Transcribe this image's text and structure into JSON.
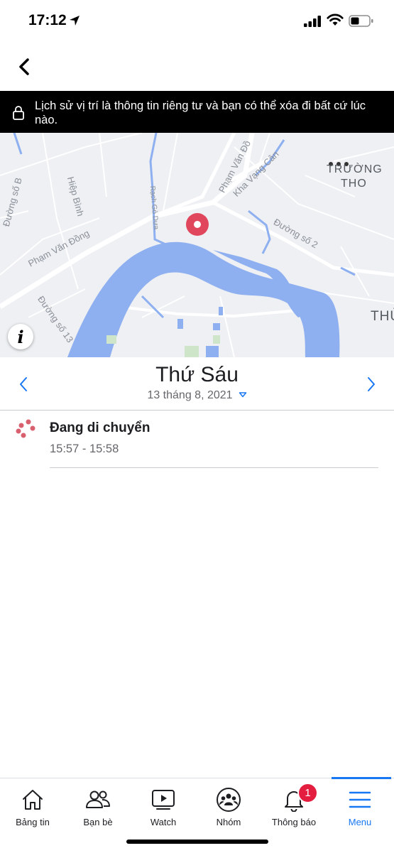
{
  "status_bar": {
    "time": "17:12",
    "icons": [
      "location-arrow-icon",
      "signal-icon",
      "wifi-icon",
      "battery-icon"
    ]
  },
  "nav": {
    "back_icon": "chevron-left-icon"
  },
  "privacy_banner": {
    "icon": "lock-icon",
    "text": "Lịch sử vị trí là thông tin riêng tư và bạn có thể xóa đi bất cứ lúc nào."
  },
  "map": {
    "labels": {
      "pham_van_dong_1": "Phạm Văn Đồng",
      "pham_van_dong_2": "Phạm Văn Đồ",
      "kha_vang_can": "Kha Vạng Cân",
      "duong_so_2": "Đường số 2",
      "duong_so_13": "Đường số 13",
      "hiep_binh": "Hiệp Bình",
      "duong_so_b": "Đường số B",
      "rach_go_dua": "Rạch Gò Dưa",
      "truong_tho_1": "TRƯỜNG",
      "truong_tho_2": "THO",
      "thu": "THỦ"
    },
    "marker_color": "#e0475c",
    "water_color": "#8fb0f0",
    "info_icon": "info-icon",
    "info_glyph": "i"
  },
  "date_header": {
    "day_name": "Thứ Sáu",
    "date": "13 tháng 8, 2021",
    "prev_icon": "chevron-left-icon",
    "next_icon": "chevron-right-icon",
    "dropdown_icon": "caret-down-icon"
  },
  "timeline": {
    "entries": [
      {
        "icon": "moving-dots-icon",
        "title": "Đang di chuyển",
        "time": "15:57 - 15:58"
      }
    ]
  },
  "tab_bar": {
    "tabs": [
      {
        "label": "Bảng tin",
        "icon": "home-icon"
      },
      {
        "label": "Bạn bè",
        "icon": "friends-icon"
      },
      {
        "label": "Watch",
        "icon": "watch-icon"
      },
      {
        "label": "Nhóm",
        "icon": "groups-icon"
      },
      {
        "label": "Thông báo",
        "icon": "bell-icon",
        "badge": "1"
      },
      {
        "label": "Menu",
        "icon": "menu-icon",
        "active": true
      }
    ],
    "accent_color": "#1877f2",
    "badge_color": "#e41e3f"
  }
}
